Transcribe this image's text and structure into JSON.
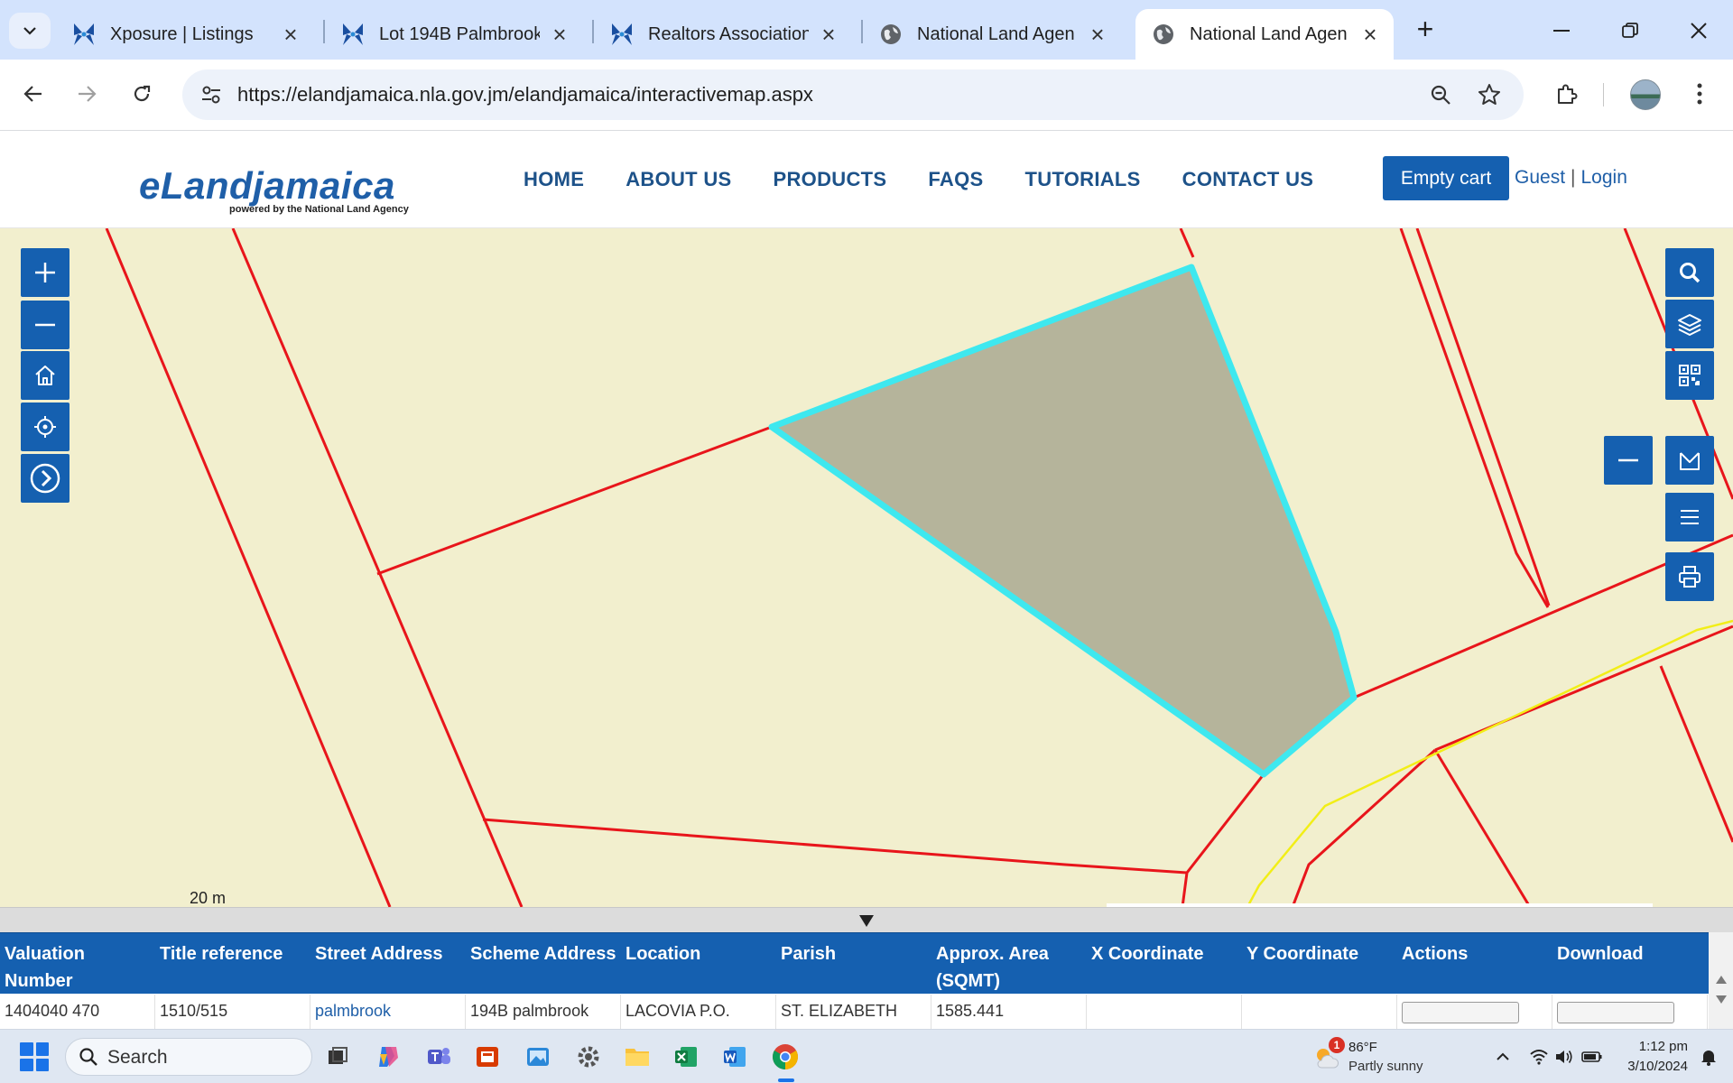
{
  "browser": {
    "tabs": [
      {
        "title": "Xposure | Listings",
        "favicon": "xposure-icon",
        "active": false
      },
      {
        "title": "Lot 194B Palmbrook",
        "favicon": "xposure-icon",
        "active": false
      },
      {
        "title": "Realtors Association",
        "favicon": "xposure-icon",
        "active": false
      },
      {
        "title": "National Land Agen",
        "favicon": "globe-icon",
        "active": false
      },
      {
        "title": "National Land Agen",
        "favicon": "globe-icon",
        "active": true
      }
    ],
    "url": "https://elandjamaica.nla.gov.jm/elandjamaica/interactivemap.aspx"
  },
  "site": {
    "logo_main": "eLandjamaica",
    "logo_sub": "powered by the National Land Agency",
    "nav": [
      "HOME",
      "ABOUT US",
      "PRODUCTS",
      "FAQS",
      "TUTORIALS",
      "CONTACT US"
    ],
    "cart_label": "Empty cart",
    "guest_label": "Guest",
    "auth_separator": "|",
    "login_label": "Login",
    "brand_color": "#1560b0"
  },
  "map": {
    "scale_label": "20 m",
    "parcel_boundary_color": "#e8151b",
    "selected_parcel_outline_color": "#3ee8ef",
    "selected_parcel_fill_color": "#b5b49b",
    "road_color": "#f2ee17",
    "background_color": "#f2efce"
  },
  "results": {
    "columns": [
      "Valuation Number",
      "Title reference",
      "Street Address",
      "Scheme Address",
      "Location",
      "Parish",
      "Approx. Area (SQMT)",
      "X Coordinate",
      "Y Coordinate",
      "Actions",
      "Download"
    ],
    "row": [
      "1404040 470",
      "1510/515",
      "palmbrook",
      "194B palmbrook",
      "LACOVIA P.O.",
      "ST. ELIZABETH",
      "1585.441",
      "",
      "",
      "",
      ""
    ]
  },
  "taskbar": {
    "search_placeholder": "Search",
    "weather_temp": "86°F",
    "weather_desc": "Partly sunny",
    "weather_badge": "1",
    "time": "1:12 pm",
    "date": "3/10/2024"
  }
}
